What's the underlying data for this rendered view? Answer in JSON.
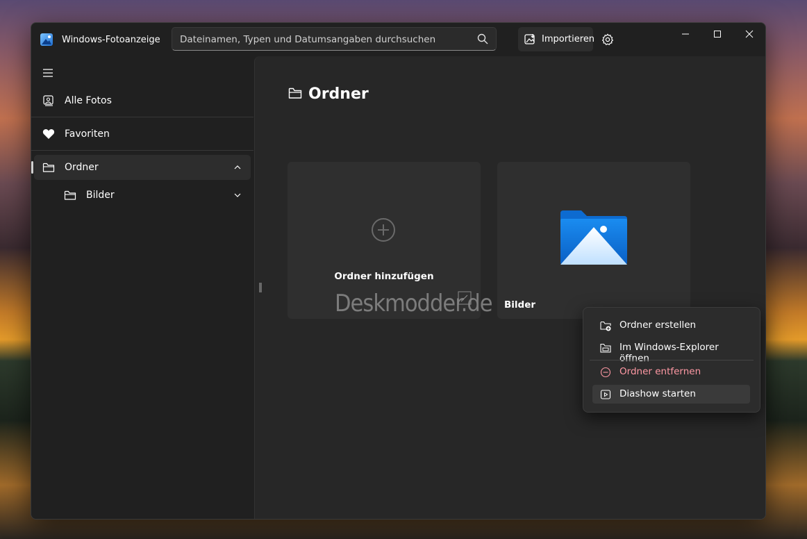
{
  "app": {
    "title": "Windows-Fotoanzeige",
    "accent_color": "#3a8ee6"
  },
  "search": {
    "placeholder": "Dateinamen, Typen und Datumsangaben durchsuchen",
    "icon": "search-icon"
  },
  "toolbar": {
    "import_label": "Importieren",
    "import_icon": "import-icon",
    "settings_icon": "gear-icon"
  },
  "window_controls": [
    "minimize-icon",
    "maximize-icon",
    "close-icon"
  ],
  "sidebar": {
    "items": [
      {
        "label": "Alle Fotos",
        "icon": "photos-icon"
      },
      {
        "label": "Favoriten",
        "icon": "heart-icon"
      },
      {
        "label": "Ordner",
        "icon": "folder-icon",
        "expanded": true,
        "selected": true
      },
      {
        "label": "Bilder",
        "icon": "folder-icon",
        "expanded": false
      }
    ]
  },
  "main": {
    "title": "Ordner",
    "tiles": [
      {
        "label": "Ordner hinzufügen",
        "icon": "plus-circle-icon"
      },
      {
        "label": "Bilder",
        "icon": "pictures-folder-icon"
      }
    ],
    "watermark": "Deskmodder.de"
  },
  "context_menu": {
    "items": [
      {
        "label": "Ordner erstellen",
        "icon": "new-folder-icon"
      },
      {
        "label": "Im Windows-Explorer öffnen",
        "icon": "explorer-icon"
      },
      {
        "label": "Ordner entfernen",
        "icon": "remove-icon",
        "color": "#ff99a4"
      },
      {
        "label": "Diashow starten",
        "icon": "slideshow-icon"
      }
    ]
  }
}
